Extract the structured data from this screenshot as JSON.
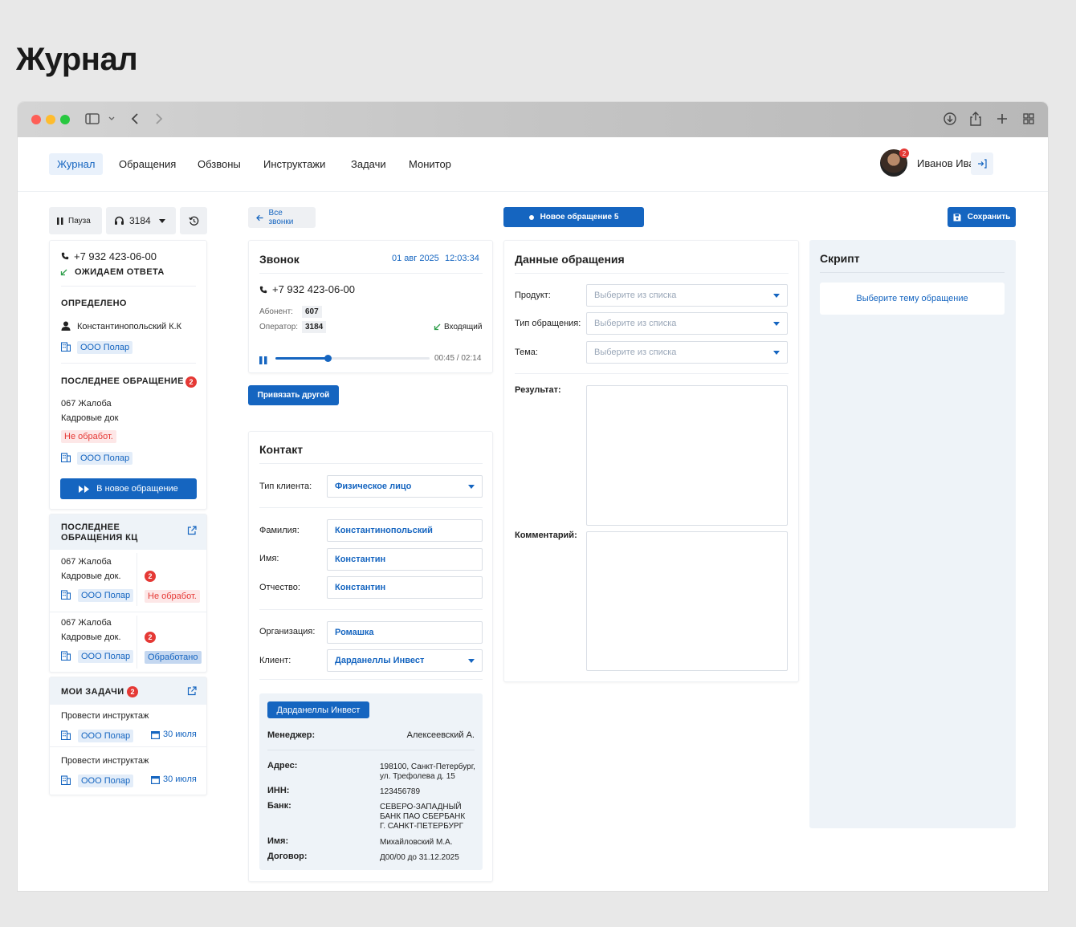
{
  "page_title": "Журнал",
  "nav": {
    "items": [
      "Журнал",
      "Обращения",
      "Обзвоны",
      "Инструктажи",
      "Задачи",
      "Монитор"
    ],
    "user_name": "Иванов Иван",
    "user_badge": "2"
  },
  "controls": {
    "pause_label": "Пауза",
    "line_number": "3184"
  },
  "call_status": {
    "phone": "+7 932 423-06-00",
    "status": "ОЖИДАЕМ ОТВЕТА"
  },
  "identified": {
    "title": "ОПРЕДЕЛЕНО",
    "person": "Константинопольский К.К",
    "org": "ООО Полар"
  },
  "last_request": {
    "title": "ПОСЛЕДНЕЕ ОБРАЩЕНИЕ",
    "badge": "2",
    "line1": "067 Жалоба",
    "line2": "Кадровые док",
    "status": "Не обработ.",
    "org": "ООО Полар",
    "button": "В новое обращение"
  },
  "last_kc": {
    "title_line1": "ПОСЛЕДНЕЕ",
    "title_line2": "ОБРАЩЕНИЯ КЦ",
    "items": [
      {
        "line1": "067 Жалоба",
        "line2": "Кадровые док.",
        "org": "ООО Полар",
        "badge": "2",
        "status": "Не обработ."
      },
      {
        "line1": "067 Жалоба",
        "line2": "Кадровые док.",
        "org": "ООО Полар",
        "badge": "2",
        "status": "Обработано"
      }
    ]
  },
  "tasks": {
    "title": "МОИ ЗАДАЧИ",
    "badge": "2",
    "items": [
      {
        "title": "Провести инструктаж",
        "org": "ООО Полар",
        "date": "30 июля"
      },
      {
        "title": "Провести инструктаж",
        "org": "ООО Полар",
        "date": "30 июля"
      }
    ]
  },
  "call": {
    "back_label": "Все звонки",
    "title": "Звонок",
    "date": "01 авг 2025",
    "time": "12:03:34",
    "phone": "+7 932 423-06-00",
    "subscriber_label": "Абонент:",
    "subscriber": "607",
    "operator_label": "Оператор:",
    "operator": "3184",
    "direction": "Входящий",
    "progress_time": "00:45 / 02:14",
    "progress": 0.336,
    "bind_button": "Привязать другой"
  },
  "contact": {
    "title": "Контакт",
    "client_type_label": "Тип клиента:",
    "client_type": "Физическое лицо",
    "lastname_label": "Фамилия:",
    "lastname": "Константинопольский",
    "firstname_label": "Имя:",
    "firstname": "Константин",
    "middlename_label": "Отчество:",
    "middlename": "Константин",
    "org_label": "Организация:",
    "org": "Ромашка",
    "client_label": "Клиент:",
    "client": "Дарданеллы Инвест",
    "info": {
      "tag": "Дарданеллы Инвест",
      "manager_label": "Менеджер:",
      "manager": "Алексеевский А.",
      "address_label": "Адрес:",
      "address_line1": "198100, Санкт-Петербург,",
      "address_line2": "ул. Трефолева д. 15",
      "inn_label": "ИНН:",
      "inn": "123456789",
      "bank_label": "Банк:",
      "bank_line1": "СЕВЕРО-ЗАПАДНЫЙ",
      "bank_line2": "БАНК ПАО СБЕРБАНК",
      "bank_line3": "Г. САНКТ-ПЕТЕРБУРГ",
      "name_label": "Имя:",
      "name": "Михайловский М.А.",
      "contract_label": "Договор:",
      "contract": "Д00/00 до 31.12.2025"
    }
  },
  "request": {
    "new_button": "Новое обращение 5",
    "title": "Данные обращения",
    "product_label": "Продукт:",
    "type_label": "Тип обращения:",
    "topic_label": "Тема:",
    "placeholder": "Выберите из списка",
    "result_label": "Результат:",
    "comment_label": "Комментарий:"
  },
  "script": {
    "save_button": "Сохранить",
    "title": "Скрипт",
    "hint": "Выберите тему обращение"
  },
  "colors": {
    "accent": "#1565c0",
    "danger": "#e53935",
    "tag_bg": "#e3edf9"
  }
}
